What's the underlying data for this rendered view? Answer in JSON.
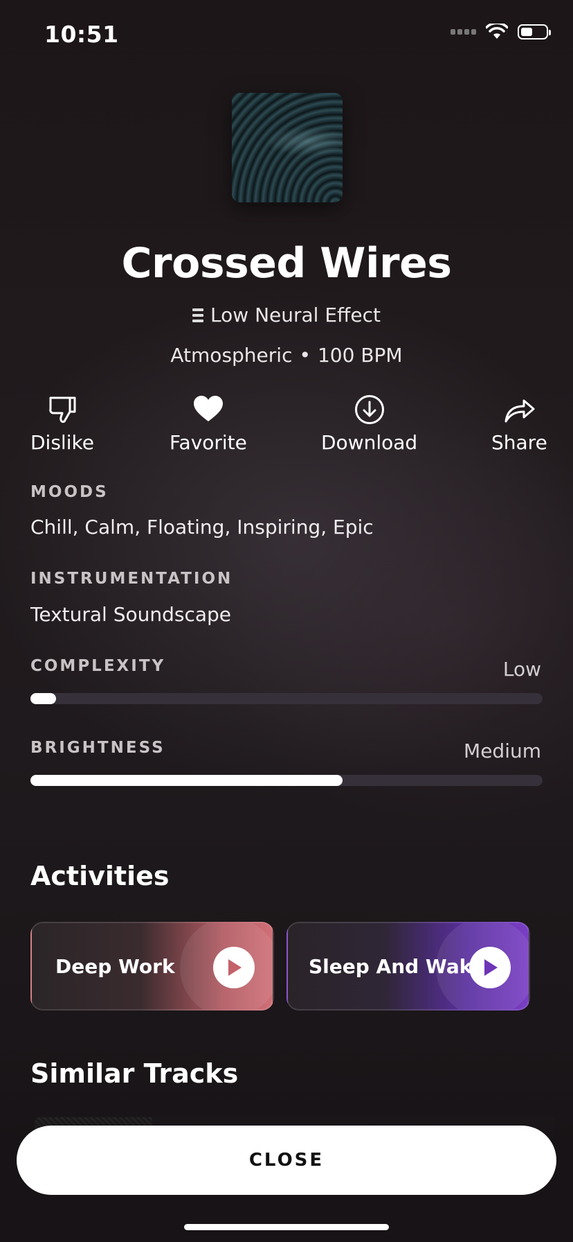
{
  "status": {
    "time": "10:51"
  },
  "track": {
    "title": "Crossed Wires",
    "effect": "Low Neural Effect",
    "genre": "Atmospheric",
    "separator": "•",
    "bpm": "100 BPM"
  },
  "actions": {
    "dislike": "Dislike",
    "favorite": "Favorite",
    "download": "Download",
    "share": "Share"
  },
  "moods": {
    "label": "MOODS",
    "value": "Chill, Calm, Floating, Inspiring, Epic"
  },
  "instrumentation": {
    "label": "INSTRUMENTATION",
    "value": "Textural Soundscape"
  },
  "complexity": {
    "label": "COMPLEXITY",
    "level": "Low",
    "fraction": 0.05
  },
  "brightness": {
    "label": "BRIGHTNESS",
    "level": "Medium",
    "fraction": 0.61
  },
  "activities": {
    "heading": "Activities",
    "items": [
      {
        "label": "Deep Work",
        "accent": "#cf7078"
      },
      {
        "label": "Sleep And Wake",
        "accent": "#7a3fc4"
      }
    ]
  },
  "similar": {
    "heading": "Similar Tracks"
  },
  "close_label": "CLOSE"
}
